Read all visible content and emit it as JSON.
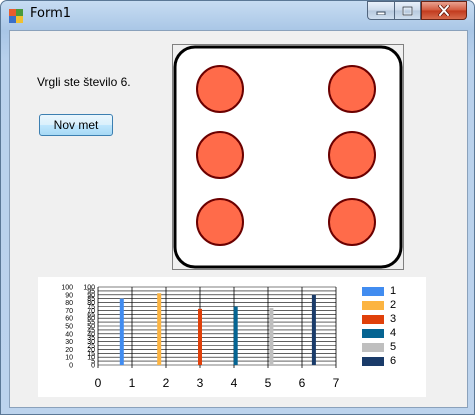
{
  "window": {
    "title": "Form1",
    "minimize_icon": "minimize-icon",
    "maximize_icon": "maximize-icon",
    "close_icon": "close-icon"
  },
  "result": {
    "text": "Vrgli ste število 6."
  },
  "roll_button": {
    "label": "Nov met"
  },
  "die": {
    "value": 6,
    "pip_color": "#ff6b4a",
    "pip_border": "#6b0000"
  },
  "chart_data": {
    "type": "bar",
    "categories": [
      "1",
      "2",
      "3",
      "4",
      "5",
      "6"
    ],
    "values": [
      85,
      92,
      72,
      75,
      73,
      90
    ],
    "x_positions": [
      0.7,
      1.8,
      3.0,
      4.05,
      5.1,
      6.35
    ],
    "xlim": [
      0,
      7
    ],
    "ylim": [
      0,
      100
    ],
    "x_ticks": [
      "0",
      "1",
      "2",
      "3",
      "4",
      "5",
      "6",
      "7"
    ],
    "y_ticks": [
      "0",
      "5",
      "10",
      "15",
      "20",
      "25",
      "30",
      "35",
      "40",
      "45",
      "50",
      "55",
      "60",
      "65",
      "70",
      "75",
      "80",
      "85",
      "90",
      "95",
      "100"
    ],
    "colors": [
      "#418cf0",
      "#fcb441",
      "#e0400a",
      "#056492",
      "#bfbfbf",
      "#1a3b69"
    ],
    "grid": true,
    "legend_position": "right",
    "legend": [
      "1",
      "2",
      "3",
      "4",
      "5",
      "6"
    ]
  }
}
